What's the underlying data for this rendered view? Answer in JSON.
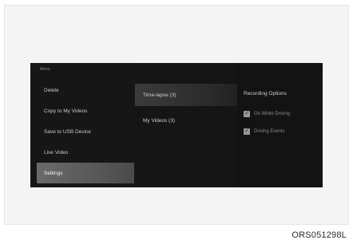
{
  "menu": {
    "header": "Menu",
    "items": [
      {
        "label": "Delete"
      },
      {
        "label": "Copy to My Videos"
      },
      {
        "label": "Save to USB Device"
      },
      {
        "label": "Live Video"
      },
      {
        "label": "Settings",
        "selected": true
      }
    ]
  },
  "folders": {
    "items": [
      {
        "label": "Time-lapse (3)",
        "selected": true
      },
      {
        "label": "My Videos (3)"
      }
    ]
  },
  "recording_options": {
    "title": "Recording Options",
    "options": [
      {
        "label": "On While Driving",
        "checked": true
      },
      {
        "label": "Driving Events",
        "checked": true
      }
    ]
  },
  "caption": "ORS051298L",
  "colors": {
    "screen_bg": "#121212",
    "selected_item": "#5e5e5e"
  }
}
